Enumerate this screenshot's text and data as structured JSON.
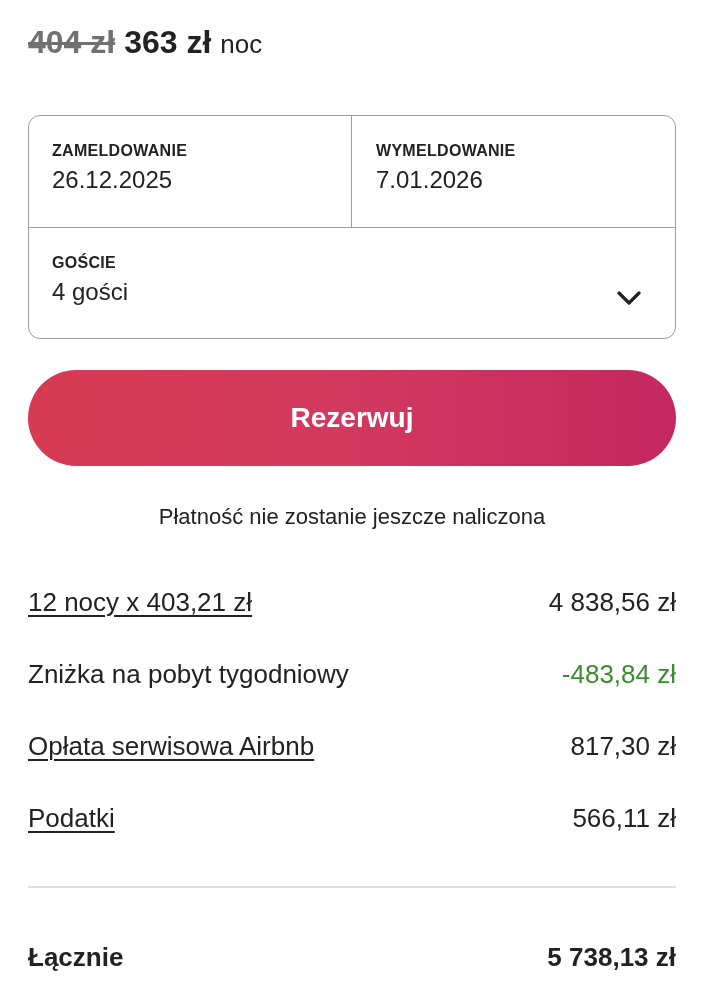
{
  "price": {
    "original": "404 zł",
    "current": "363 zł",
    "unit": "noc"
  },
  "booking": {
    "dates": [
      {
        "label": "ZAMELDOWANIE",
        "value": "26.12.2025"
      },
      {
        "label": "WYMELDOWANIE",
        "value": "7.01.2026"
      }
    ],
    "guests": {
      "label": "GOŚCIE",
      "value": "4 gości"
    }
  },
  "reserve_button": {
    "label": "Rezerwuj"
  },
  "note": "Płatność nie zostanie jeszcze naliczona",
  "breakdown": [
    {
      "kind": "link",
      "label": "12 nocy x 403,21 zł",
      "amount": "4 838,56 zł"
    },
    {
      "kind": "discount",
      "label": "Zniżka na pobyt tygodniowy",
      "amount": "-483,84 zł"
    },
    {
      "kind": "link",
      "label": "Opłata serwisowa Airbnb",
      "amount": "817,30 zł"
    },
    {
      "kind": "link",
      "label": "Podatki",
      "amount": "566,11 zł"
    }
  ],
  "total": {
    "label": "Łącznie",
    "amount": "5 738,13 zł"
  }
}
